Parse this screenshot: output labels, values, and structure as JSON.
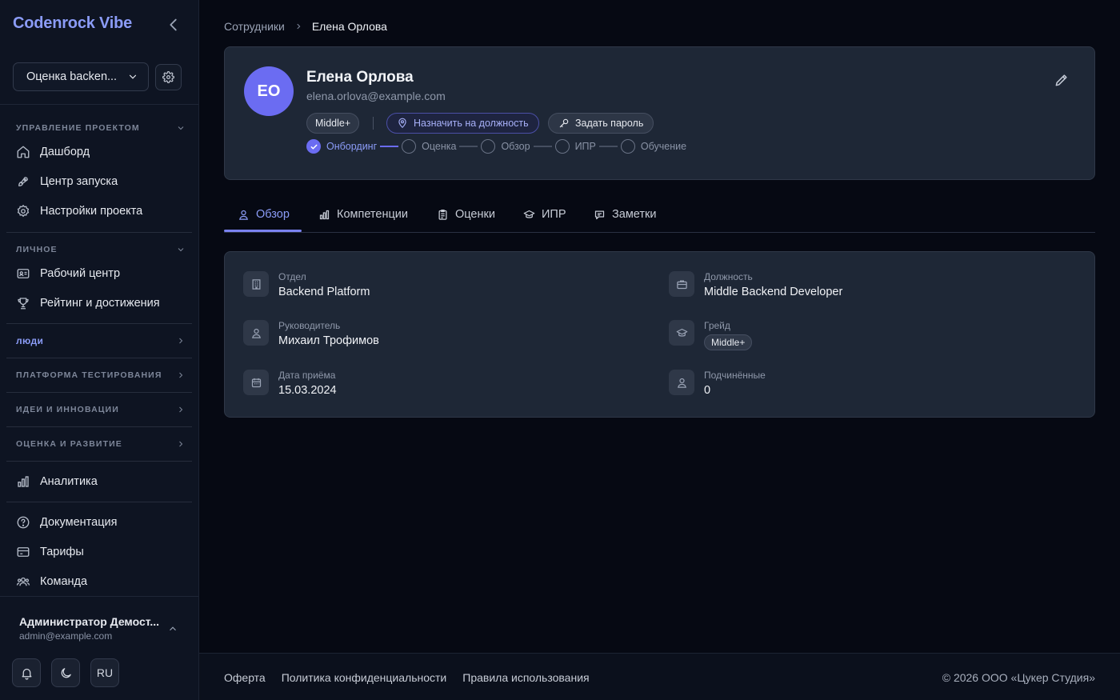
{
  "brand": "Codenrock Vibe",
  "project": {
    "selected": "Оценка backen..."
  },
  "sidebar": {
    "sections": [
      {
        "label": "Управление проектом",
        "items": [
          "Дашборд",
          "Центр запуска",
          "Настройки проекта"
        ]
      },
      {
        "label": "Личное",
        "items": [
          "Рабочий центр",
          "Рейтинг и достижения"
        ]
      }
    ],
    "collapsed": [
      "Люди",
      "Платформа тестирования",
      "Идеи и инновации",
      "Оценка и развитие"
    ],
    "analytics": "Аналитика",
    "bottom_items": [
      "Документация",
      "Тарифы",
      "Команда"
    ],
    "user": {
      "name": "Администратор Демост...",
      "email": "admin@example.com"
    },
    "lang": "RU"
  },
  "breadcrumb": {
    "parent": "Сотрудники",
    "current": "Елена Орлова"
  },
  "profile": {
    "initials": "ЕО",
    "name": "Елена Орлова",
    "email": "elena.orlova@example.com",
    "grade": "Middle+",
    "assign_label": "Назначить на должность",
    "password_label": "Задать пароль",
    "steps": [
      "Онбординг",
      "Оценка",
      "Обзор",
      "ИПР",
      "Обучение"
    ],
    "completed_steps": 1
  },
  "tabs": [
    "Обзор",
    "Компетенции",
    "Оценки",
    "ИПР",
    "Заметки"
  ],
  "active_tab": "Обзор",
  "info": {
    "department": {
      "label": "Отдел",
      "value": "Backend Platform"
    },
    "position": {
      "label": "Должность",
      "value": "Middle Backend Developer"
    },
    "manager": {
      "label": "Руководитель",
      "value": "Михаил Трофимов"
    },
    "grade": {
      "label": "Грейд",
      "value": "Middle+"
    },
    "hire_date": {
      "label": "Дата приёма",
      "value": "15.03.2024"
    },
    "subordinates": {
      "label": "Подчинённые",
      "value": "0"
    }
  },
  "footer": {
    "links": [
      "Оферта",
      "Политика конфиденциальности",
      "Правила использования"
    ],
    "copyright": "© 2026 ООО «Цукер Студия»"
  },
  "colors": {
    "accent": "#6b6cf2",
    "background": "#060913",
    "sidebar": "#0e1422",
    "card": "#1e2736"
  }
}
